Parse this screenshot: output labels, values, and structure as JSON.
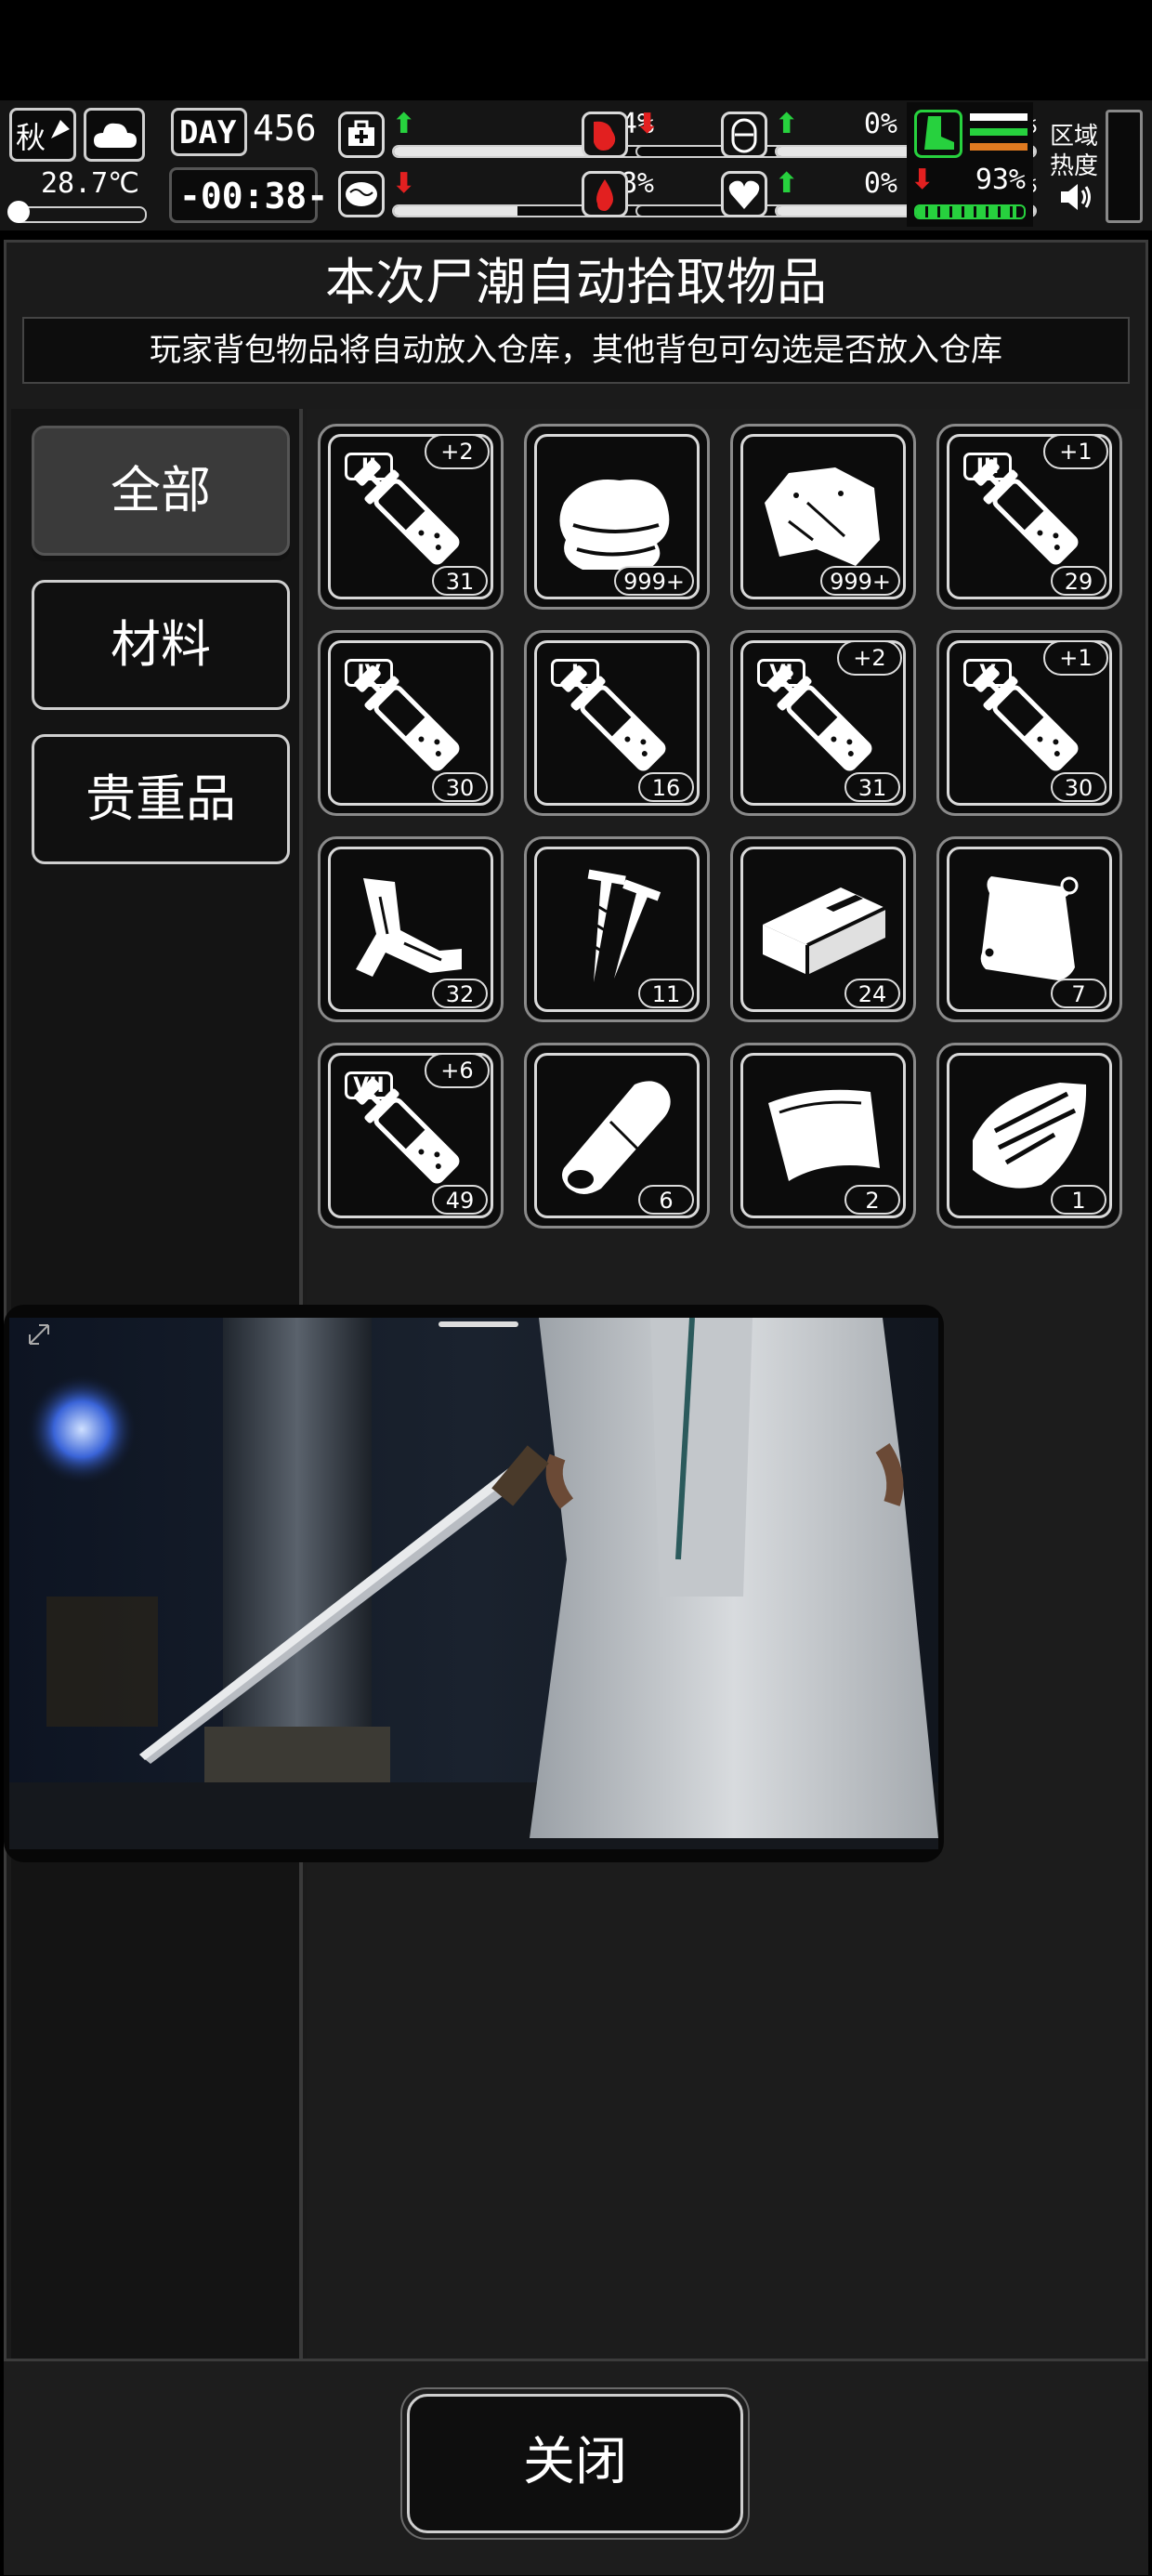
{
  "status": {
    "season": "秋",
    "temperature": "28.7℃",
    "day_label": "DAY",
    "day_number": "456",
    "clock": "-00:38-",
    "stats": [
      {
        "icon": "medkit-icon",
        "trend": "up",
        "value": "84%",
        "level": 0.84
      },
      {
        "icon": "stomach-icon",
        "trend": "down",
        "value": "0%",
        "level": 0.0
      },
      {
        "icon": "shield-icon",
        "trend": "up",
        "value": "100%",
        "level": 1.0
      },
      {
        "icon": "brain-icon",
        "trend": "down",
        "value": "48%",
        "level": 0.48
      },
      {
        "icon": "blood-drop-icon",
        "trend": "none",
        "value": "0%",
        "level": 0.0
      },
      {
        "icon": "heart-icon",
        "trend": "up",
        "value": "100%",
        "level": 1.0
      }
    ],
    "stamina": {
      "icon": "boot-icon",
      "trend": "down",
      "value": "93%",
      "level": 0.93
    },
    "zone_heat_label_1": "区域",
    "zone_heat_label_2": "热度"
  },
  "panel": {
    "title": "本次尸潮自动拾取物品",
    "subtitle": "玩家背包物品将自动放入仓库，其他背包可勾选是否放入仓库"
  },
  "categories": [
    {
      "label": "全部",
      "active": true
    },
    {
      "label": "材料",
      "active": false
    },
    {
      "label": "贵重品",
      "active": false
    }
  ],
  "items": [
    {
      "icon": "syringe-icon",
      "roman": "II",
      "bonus": "+2",
      "count": "31"
    },
    {
      "icon": "cloth-stack-icon",
      "roman": "",
      "bonus": "",
      "count": "999+"
    },
    {
      "icon": "fabric-scrap-icon",
      "roman": "",
      "bonus": "",
      "count": "999+"
    },
    {
      "icon": "syringe-icon",
      "roman": "III",
      "bonus": "+1",
      "count": "29"
    },
    {
      "icon": "syringe-icon",
      "roman": "IV",
      "bonus": "",
      "count": "30"
    },
    {
      "icon": "syringe-icon",
      "roman": "I",
      "bonus": "",
      "count": "16"
    },
    {
      "icon": "syringe-icon",
      "roman": "VI",
      "bonus": "+2",
      "count": "31"
    },
    {
      "icon": "syringe-icon",
      "roman": "V",
      "bonus": "+1",
      "count": "30"
    },
    {
      "icon": "bandage-strip-icon",
      "roman": "",
      "bonus": "",
      "count": "32"
    },
    {
      "icon": "nails-icon",
      "roman": "",
      "bonus": "",
      "count": "11"
    },
    {
      "icon": "brick-icon",
      "roman": "",
      "bonus": "",
      "count": "24"
    },
    {
      "icon": "plastic-bag-icon",
      "roman": "",
      "bonus": "",
      "count": "7"
    },
    {
      "icon": "syringe-icon",
      "roman": "VII",
      "bonus": "+6",
      "count": "49"
    },
    {
      "icon": "rolled-cloth-icon",
      "roman": "",
      "bonus": "",
      "count": "6"
    },
    {
      "icon": "leather-piece-icon",
      "roman": "",
      "bonus": "",
      "count": "2"
    },
    {
      "icon": "metal-shard-icon",
      "roman": "",
      "bonus": "",
      "count": "1"
    }
  ],
  "close_label": "关闭",
  "colors": {
    "up": "#27d13e",
    "down": "#e22020",
    "panel": "#1b1b1b",
    "stamina": "#27d13e"
  }
}
